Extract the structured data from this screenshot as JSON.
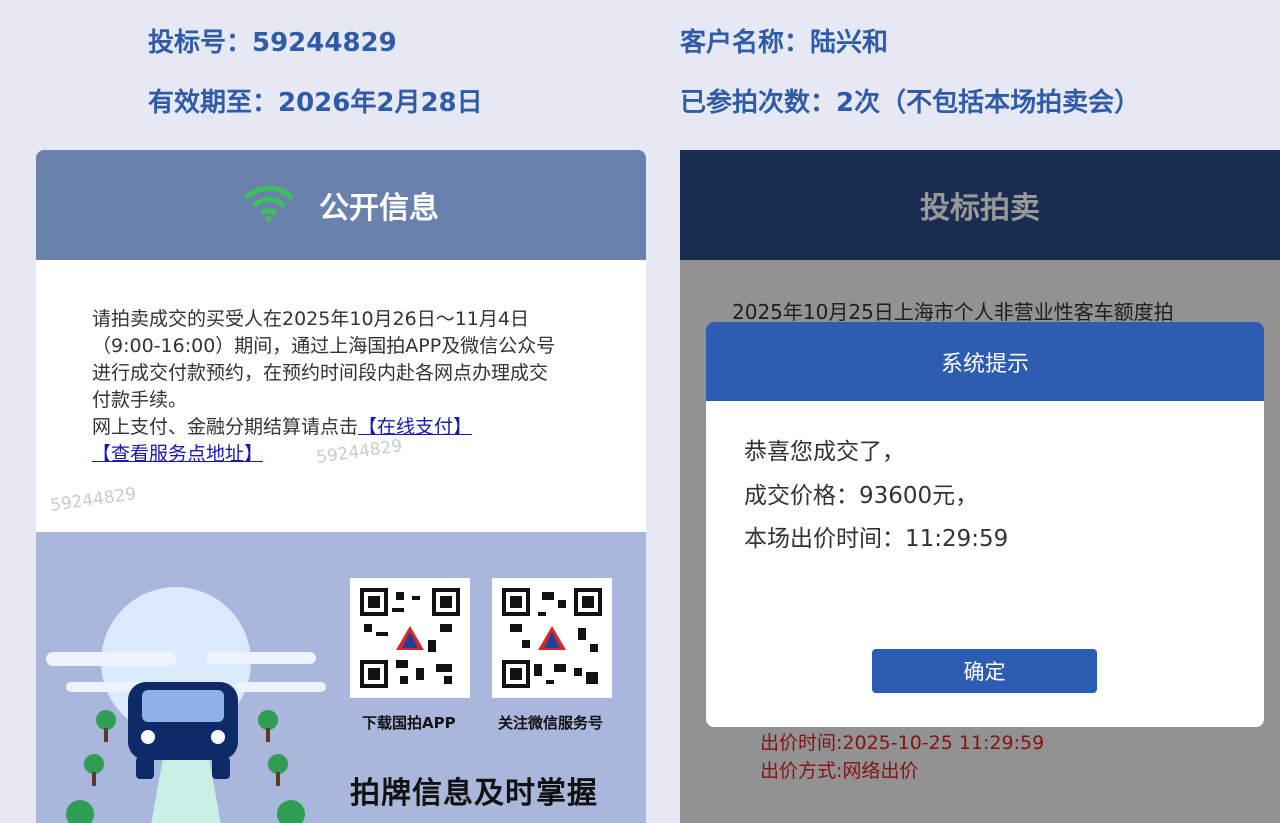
{
  "header": {
    "bid_number": "投标号：59244829",
    "valid_until": "有效期至：2026年2月28日",
    "customer_name": "客户名称：陆兴和",
    "participation_count": "已参拍次数：2次（不包括本场拍卖会）"
  },
  "public_info": {
    "title": "公开信息",
    "notice_lines": [
      "请拍卖成交的买受人在2025年10月26日～11月4日",
      "（9:00-16:00）期间，通过上海国拍APP及微信公众号",
      "进行成交付款预约，在预约时间段内赴各网点办理成交",
      "付款手续。",
      "网上支付、金融分期结算请点击"
    ],
    "link_online_pay": "【在线支付】",
    "link_service_points": "【查看服务点地址】",
    "watermark": "59244829",
    "qr_app_label": "下载国拍APP",
    "qr_wechat_label": "关注微信服务号",
    "slogan": "拍牌信息及时掌握"
  },
  "auction": {
    "title": "投标拍卖",
    "description": "2025年10月25日上海市个人非营业性客车额度拍",
    "bid_time": "出价时间:2025-10-25 11:29:59",
    "bid_method": "出价方式:网络出价"
  },
  "modal": {
    "title": "系统提示",
    "line1": "恭喜您成交了，",
    "line2": "成交价格：93600元，",
    "line3": "本场出价时间：11:29:59",
    "confirm": "确定"
  },
  "colors": {
    "header_text": "#2f5ba8",
    "left_head_bg": "#6a80ad",
    "right_head_bg": "#2d4a87",
    "modal_accent": "#2d5cb3",
    "bid_red": "#e02020",
    "wifi_green": "#3dbf5a"
  }
}
